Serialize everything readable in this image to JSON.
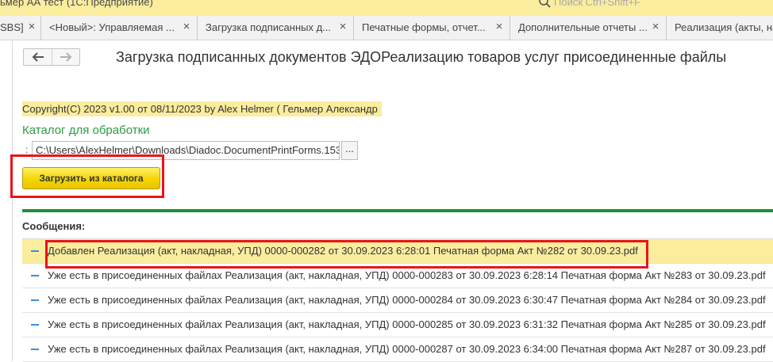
{
  "window": {
    "app_title": "ьмер АА тест  (1С:Предприятие)",
    "search_placeholder": "Поиск Ctrl+Shift+F",
    "search_icon": "search-icon"
  },
  "tabs": [
    {
      "label": "SBS]",
      "close": "×"
    },
    {
      "label": "<Новый>: Управляемая ...",
      "close": "×"
    },
    {
      "label": "Загрузка подписанных д...",
      "close": "×"
    },
    {
      "label": "Печатные формы, отчет...",
      "close": "×"
    },
    {
      "label": "Дополнительные отчеты ...",
      "close": "×"
    },
    {
      "label": "Реализация (акты, накл",
      "close": ""
    }
  ],
  "nav": {
    "back_icon": "arrow-left-icon",
    "forward_icon": "arrow-right-icon"
  },
  "form": {
    "title": "Загрузка подписанных документов ЭДОРеализацию товаров услуг присоединенные файлы",
    "copyright": "Copyright(C)  2023 v1.00 от 08/11/2023  by Alex Helmer ( Гельмер Александр",
    "catalog_label": "Каталог для обработки",
    "catalog_colon": ":",
    "catalog_path": "C:\\Users\\AlexHelmer\\Downloads\\Diadoc.DocumentPrintForms.153",
    "browse_label": "...",
    "load_button": "Загрузить из каталога",
    "messages_label": "Сообщения:"
  },
  "messages": [
    {
      "text": "Добавлен Реализация (акт, накладная, УПД) 0000-000282 от 30.09.2023 6:28:01 Печатная форма Акт №282 от 30.09.23.pdf",
      "selected": true
    },
    {
      "text": "Уже есть в присоединенных файлах Реализация (акт, накладная, УПД) 0000-000283 от 30.09.2023 6:28:14 Печатная форма Акт №283 от 30.09.23.pdf",
      "selected": false
    },
    {
      "text": "Уже есть в присоединенных файлах Реализация (акт, накладная, УПД) 0000-000284 от 30.09.2023 6:30:47 Печатная форма Акт №284 от 30.09.23.pdf",
      "selected": false
    },
    {
      "text": "Уже есть в присоединенных файлах Реализация (акт, накладная, УПД) 0000-000285 от 30.09.2023 6:31:32 Печатная форма Акт №285 от 30.09.23.pdf",
      "selected": false
    },
    {
      "text": "Уже есть в присоединенных файлах Реализация (акт, накладная, УПД) 0000-000287 от 30.09.2023 6:34:00 Печатная форма Акт №287 от 30.09.23.pdf",
      "selected": false
    }
  ],
  "colors": {
    "accent_yellow": "#fbed9e",
    "button_yellow": "#f5d500",
    "catalog_green": "#2e9a44",
    "separator_green": "#1f8f3e",
    "highlight_red": "#e8141a",
    "message_dash_blue": "#3a8fd6"
  }
}
